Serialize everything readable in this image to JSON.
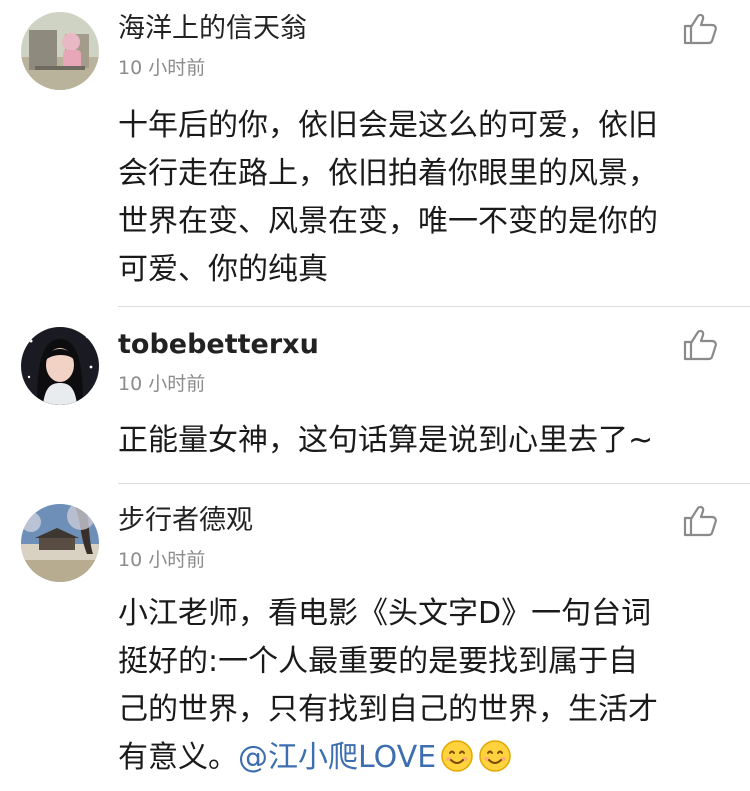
{
  "comments": [
    {
      "username": "海洋上的信天翁",
      "time": "10 小时前",
      "content_lines": [
        "十年后的你，依旧会是这么的可爱，依旧",
        "会行走在路上，依旧拍着你眼里的风景，",
        "世界在变、风景在变，唯一不变的是你的",
        "可爱、你的纯真"
      ]
    },
    {
      "username": "tobebetterxu",
      "time": "10 小时前",
      "content_lines": [
        "正能量女神，这句话算是说到心里去了~"
      ]
    },
    {
      "username": "步行者德观",
      "time": "10 小时前",
      "content_lines": [
        "小江老师，看电影《头文字D》一句台词",
        "挺好的:一个人最重要的是要找到属于自",
        "己的世界，只有找到自己的世界，生活才",
        "有意义。"
      ],
      "mention": "@江小爬LOVE"
    }
  ],
  "icons": {
    "like": "thumbs-up-icon",
    "emoji": "smiling-face-emoji"
  },
  "colors": {
    "mention": "#3d6fb0",
    "time": "#8c8c8c",
    "divider": "#dcdcdc"
  }
}
